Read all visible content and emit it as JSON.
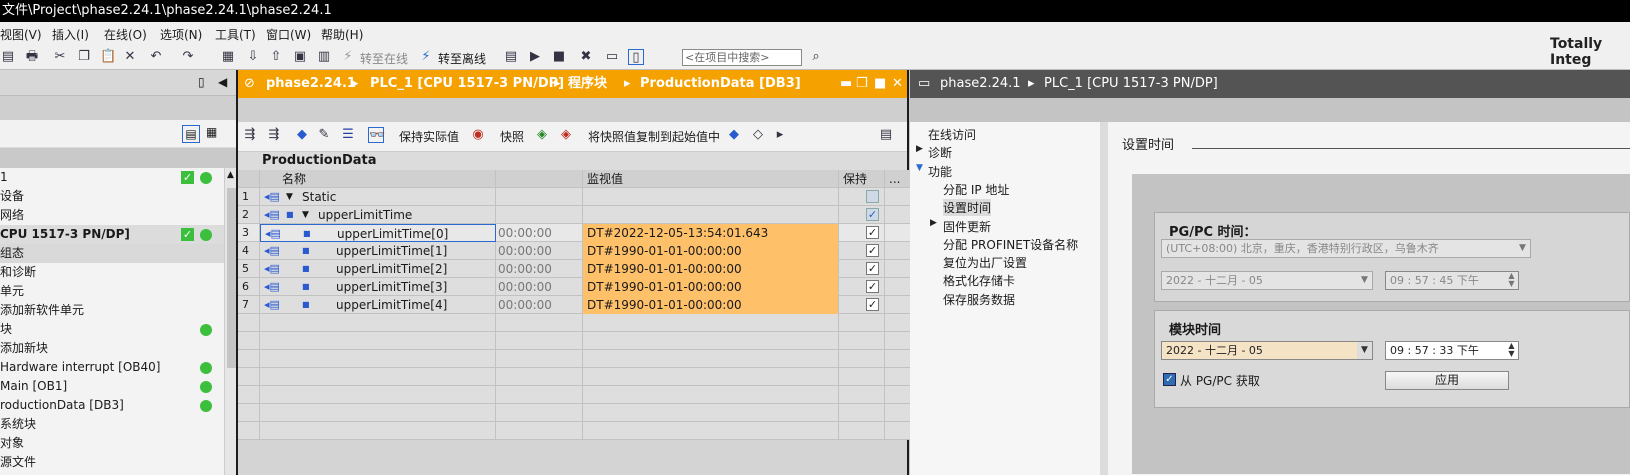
{
  "window": {
    "title": "文件\\Project\\phase2.24.1\\phase2.24.1\\phase2.24.1",
    "brand": "Totally Integ"
  },
  "menu": [
    "视图(V)",
    "插入(I)",
    "在线(O)",
    "选项(N)",
    "工具(T)",
    "窗口(W)",
    "帮助(H)"
  ],
  "toolbar": {
    "go_online": "转至在线",
    "go_offline": "转至离线",
    "search_placeholder": "<在项目中搜索>"
  },
  "project_tree": {
    "items": [
      {
        "label": "1",
        "status": "check+dot"
      },
      {
        "label": "设备",
        "status": ""
      },
      {
        "label": "网络",
        "status": ""
      },
      {
        "label": "CPU 1517-3 PN/DP]",
        "status": "check+dot",
        "bold": true
      },
      {
        "label": "组态",
        "status": "",
        "selected": true
      },
      {
        "label": "和诊断",
        "status": ""
      },
      {
        "label": "单元",
        "status": ""
      },
      {
        "label": "添加新软件单元",
        "status": ""
      },
      {
        "label": "块",
        "status": "dot"
      },
      {
        "label": "添加新块",
        "status": ""
      },
      {
        "label": "Hardware interrupt [OB40]",
        "status": "dot"
      },
      {
        "label": "Main [OB1]",
        "status": "dot"
      },
      {
        "label": "roductionData [DB3]",
        "status": "dot"
      },
      {
        "label": "系统块",
        "status": ""
      },
      {
        "label": "对象",
        "status": ""
      },
      {
        "label": "源文件",
        "status": ""
      }
    ]
  },
  "editor": {
    "breadcrumb": [
      "phase2.24.1",
      "PLC_1 [CPU 1517-3 PN/DP]",
      "程序块",
      "ProductionData [DB3]"
    ],
    "toolbar": {
      "keep_actual": "保持实际值",
      "snapshot": "快照",
      "copy_snapshot": "将快照值复制到起始值中"
    },
    "block_name": "ProductionData",
    "columns": {
      "name": "名称",
      "monitor": "监视值",
      "retain": "保持",
      "more": "..."
    },
    "rows": [
      {
        "no": "1",
        "name": "Static",
        "start": "",
        "monitor": "",
        "retain": "disabled",
        "level": 0,
        "expand": "▼"
      },
      {
        "no": "2",
        "name": "upperLimitTime",
        "start": "",
        "monitor": "",
        "retain": "checked-blue",
        "level": 1,
        "expand": "▼"
      },
      {
        "no": "3",
        "name": "upperLimitTime[0]",
        "start": "00:00:00",
        "monitor": "DT#2022-12-05-13:54:01.643",
        "retain": "checked",
        "level": 2,
        "expand": ""
      },
      {
        "no": "4",
        "name": "upperLimitTime[1]",
        "start": "00:00:00",
        "monitor": "DT#1990-01-01-00:00:00",
        "retain": "checked",
        "level": 2,
        "expand": ""
      },
      {
        "no": "5",
        "name": "upperLimitTime[2]",
        "start": "00:00:00",
        "monitor": "DT#1990-01-01-00:00:00",
        "retain": "checked",
        "level": 2,
        "expand": ""
      },
      {
        "no": "6",
        "name": "upperLimitTime[3]",
        "start": "00:00:00",
        "monitor": "DT#1990-01-01-00:00:00",
        "retain": "checked",
        "level": 2,
        "expand": ""
      },
      {
        "no": "7",
        "name": "upperLimitTime[4]",
        "start": "00:00:00",
        "monitor": "DT#1990-01-01-00:00:00",
        "retain": "checked",
        "level": 2,
        "expand": ""
      }
    ]
  },
  "online_panel": {
    "breadcrumb": [
      "phase2.24.1",
      "PLC_1 [CPU 1517-3 PN/DP]"
    ],
    "nav": [
      {
        "label": "在线访问",
        "indent": 0,
        "arrow": ""
      },
      {
        "label": "诊断",
        "indent": 0,
        "arrow": "▶"
      },
      {
        "label": "功能",
        "indent": 0,
        "arrow": "▼"
      },
      {
        "label": "分配 IP 地址",
        "indent": 2,
        "arrow": ""
      },
      {
        "label": "设置时间",
        "indent": 2,
        "arrow": "",
        "selected": true
      },
      {
        "label": "固件更新",
        "indent": 1,
        "arrow": "▶"
      },
      {
        "label": "分配 PROFINET设备名称",
        "indent": 2,
        "arrow": ""
      },
      {
        "label": "复位为出厂设置",
        "indent": 2,
        "arrow": ""
      },
      {
        "label": "格式化存储卡",
        "indent": 2,
        "arrow": ""
      },
      {
        "label": "保存服务数据",
        "indent": 2,
        "arrow": ""
      }
    ],
    "section_title": "设置时间",
    "pgpc": {
      "title": "PG/PC 时间：",
      "timezone": "(UTC+08:00) 北京，重庆，香港特别行政区，乌鲁木齐",
      "date": "2022 - 十二月  - 05",
      "time": "09 : 57 : 45    下午"
    },
    "module": {
      "title": "模块时间",
      "date": "2022 - 十二月  - 05",
      "time": "09 : 57 : 33    下午",
      "sync_label": "从 PG/PC 获取",
      "apply": "应用"
    }
  }
}
